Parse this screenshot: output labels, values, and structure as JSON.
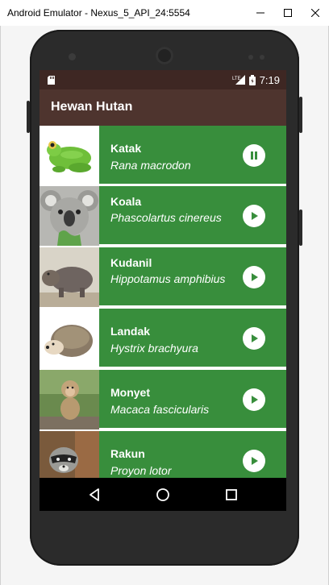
{
  "window": {
    "title": "Android Emulator - Nexus_5_API_24:5554"
  },
  "status_bar": {
    "network": "LTE",
    "time": "7:19"
  },
  "app_bar": {
    "title": "Hewan Hutan"
  },
  "animals": [
    {
      "name": "Katak",
      "scientific": "Rana macrodon",
      "state": "playing",
      "icon": "pause-icon"
    },
    {
      "name": "Koala",
      "scientific": "Phascolartus cinereus",
      "state": "stopped",
      "icon": "play-icon"
    },
    {
      "name": "Kudanil",
      "scientific": "Hippotamus amphibius",
      "state": "stopped",
      "icon": "play-icon"
    },
    {
      "name": "Landak",
      "scientific": "Hystrix brachyura",
      "state": "stopped",
      "icon": "play-icon"
    },
    {
      "name": "Monyet",
      "scientific": "Macaca fascicularis",
      "state": "stopped",
      "icon": "play-icon"
    },
    {
      "name": "Rakun",
      "scientific": "Proyon lotor",
      "state": "stopped",
      "icon": "play-icon"
    }
  ],
  "colors": {
    "status_bar": "#3e2723",
    "app_bar": "#4e342e",
    "list_item": "#388e3c",
    "text": "#ffffff"
  },
  "nav": {
    "back_icon": "back-icon",
    "home_icon": "home-icon",
    "recents_icon": "recents-icon"
  }
}
